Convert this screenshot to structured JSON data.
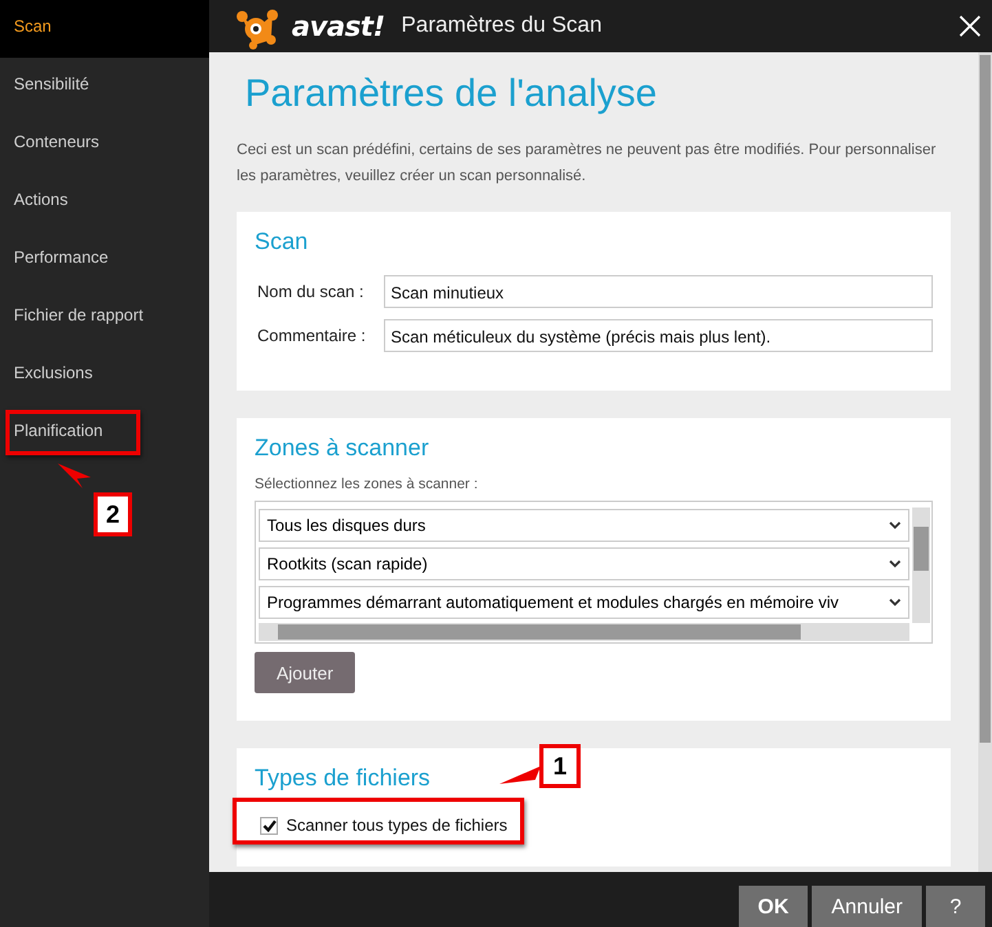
{
  "sidebar": {
    "items": [
      {
        "label": "Scan",
        "selected": true
      },
      {
        "label": "Sensibilité",
        "selected": false
      },
      {
        "label": "Conteneurs",
        "selected": false
      },
      {
        "label": "Actions",
        "selected": false
      },
      {
        "label": "Performance",
        "selected": false
      },
      {
        "label": "Fichier de rapport",
        "selected": false
      },
      {
        "label": "Exclusions",
        "selected": false
      },
      {
        "label": "Planification",
        "selected": false
      }
    ]
  },
  "header": {
    "logo": "avast!",
    "title": "Paramètres du Scan"
  },
  "page": {
    "title": "Paramètres de l'analyse",
    "description": "Ceci est un scan prédéfini, certains de ses paramètres ne peuvent pas être modifiés. Pour personnaliser les paramètres, veuillez créer un scan personnalisé."
  },
  "scan_section": {
    "heading": "Scan",
    "fields": [
      {
        "label": "Nom du scan :",
        "value": "Scan minutieux"
      },
      {
        "label": "Commentaire :",
        "value": "Scan méticuleux du système (précis mais plus lent)."
      }
    ]
  },
  "zones_section": {
    "heading": "Zones à scanner",
    "prompt": "Sélectionnez les zones à scanner :",
    "zones": [
      {
        "value": "Tous les disques durs"
      },
      {
        "value": "Rootkits (scan rapide)"
      },
      {
        "value": "Programmes démarrant automatiquement et modules chargés en mémoire viv"
      }
    ],
    "add_button": "Ajouter"
  },
  "file_types_section": {
    "heading": "Types de fichiers",
    "checkbox": {
      "label": "Scanner tous types de fichiers",
      "checked": true
    }
  },
  "footer": {
    "buttons": [
      {
        "label": "OK",
        "kind": "primary"
      },
      {
        "label": "Annuler",
        "kind": "secondary"
      },
      {
        "label": "?",
        "kind": "secondary"
      }
    ]
  },
  "annotations": [
    {
      "kind": "checkbox-callout",
      "number": "1"
    },
    {
      "kind": "sidebar-callout",
      "number": "2"
    }
  ]
}
